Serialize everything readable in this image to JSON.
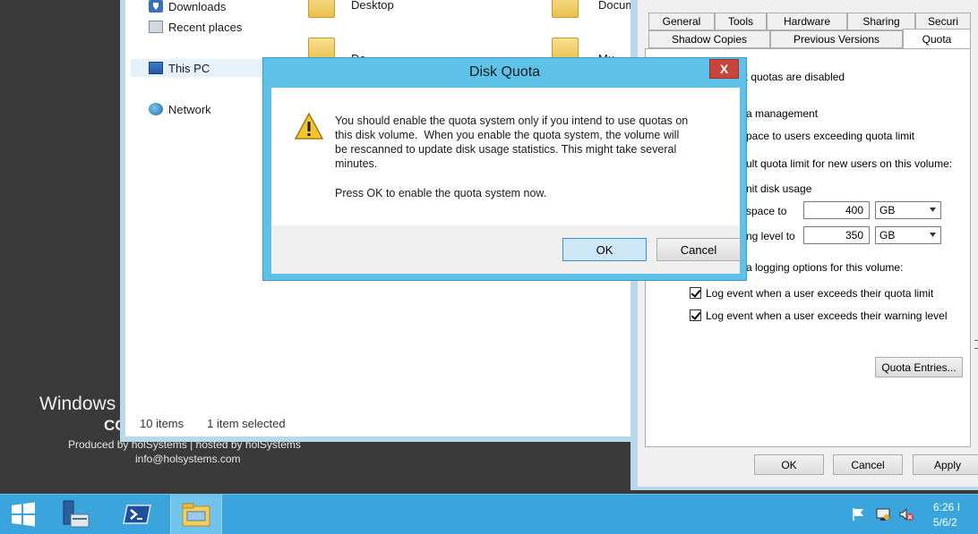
{
  "desktop": {
    "brand_line1": "Windows",
    "brand_line2": "CC",
    "produced_by": "Produced by holSystems | hosted by holSystems",
    "email": "info@holsystems.com"
  },
  "explorer": {
    "nav": {
      "downloads": "Downloads",
      "recent_places": "Recent places",
      "this_pc": "This PC",
      "network": "Network"
    },
    "folders": {
      "desktop": "Desktop",
      "documents": "Docum",
      "downloads_partial": "Do",
      "music_partial": "Mu"
    },
    "status": {
      "items": "10 items",
      "selected": "1 item selected"
    }
  },
  "properties": {
    "tabs_row1": [
      "General",
      "Tools",
      "Hardware",
      "Sharing",
      "Securi"
    ],
    "tabs_row2": [
      "Shadow Copies",
      "Previous Versions",
      "Quota"
    ],
    "active_tab": "Quota",
    "quota": {
      "status_text": "k quotas are disabled",
      "management_text": "a management",
      "deny_text": "pace to users exceeding quota limit",
      "default_text": "ult quota limit for new users on this volume:",
      "limit_text": "nit disk usage",
      "space_to_label": "space to",
      "warning_label": "ng level to",
      "limit_value": "400",
      "limit_unit": "GB",
      "warning_value": "350",
      "warning_unit": "GB",
      "logging_text": "a logging options for this volume:",
      "log_quota_label": "Log event when a user exceeds their quota limit",
      "log_warning_label": "Log event when a user exceeds their warning level",
      "log_quota_checked": true,
      "log_warning_checked": true,
      "entries_button": "Quota Entries..."
    },
    "buttons": {
      "ok": "OK",
      "cancel": "Cancel",
      "apply": "Apply"
    }
  },
  "dialog": {
    "title": "Disk Quota",
    "close_symbol": "X",
    "message_lines": [
      "You should enable the quota system only if you intend to use quotas on",
      "this disk volume.  When you enable the quota system, the volume will",
      "be rescanned to update disk usage statistics. This might take several",
      "minutes."
    ],
    "prompt": "Press OK to enable the quota system now.",
    "ok_label": "OK",
    "cancel_label": "Cancel"
  },
  "taskbar": {
    "time": "6:26 I",
    "date": "5/6/2"
  }
}
